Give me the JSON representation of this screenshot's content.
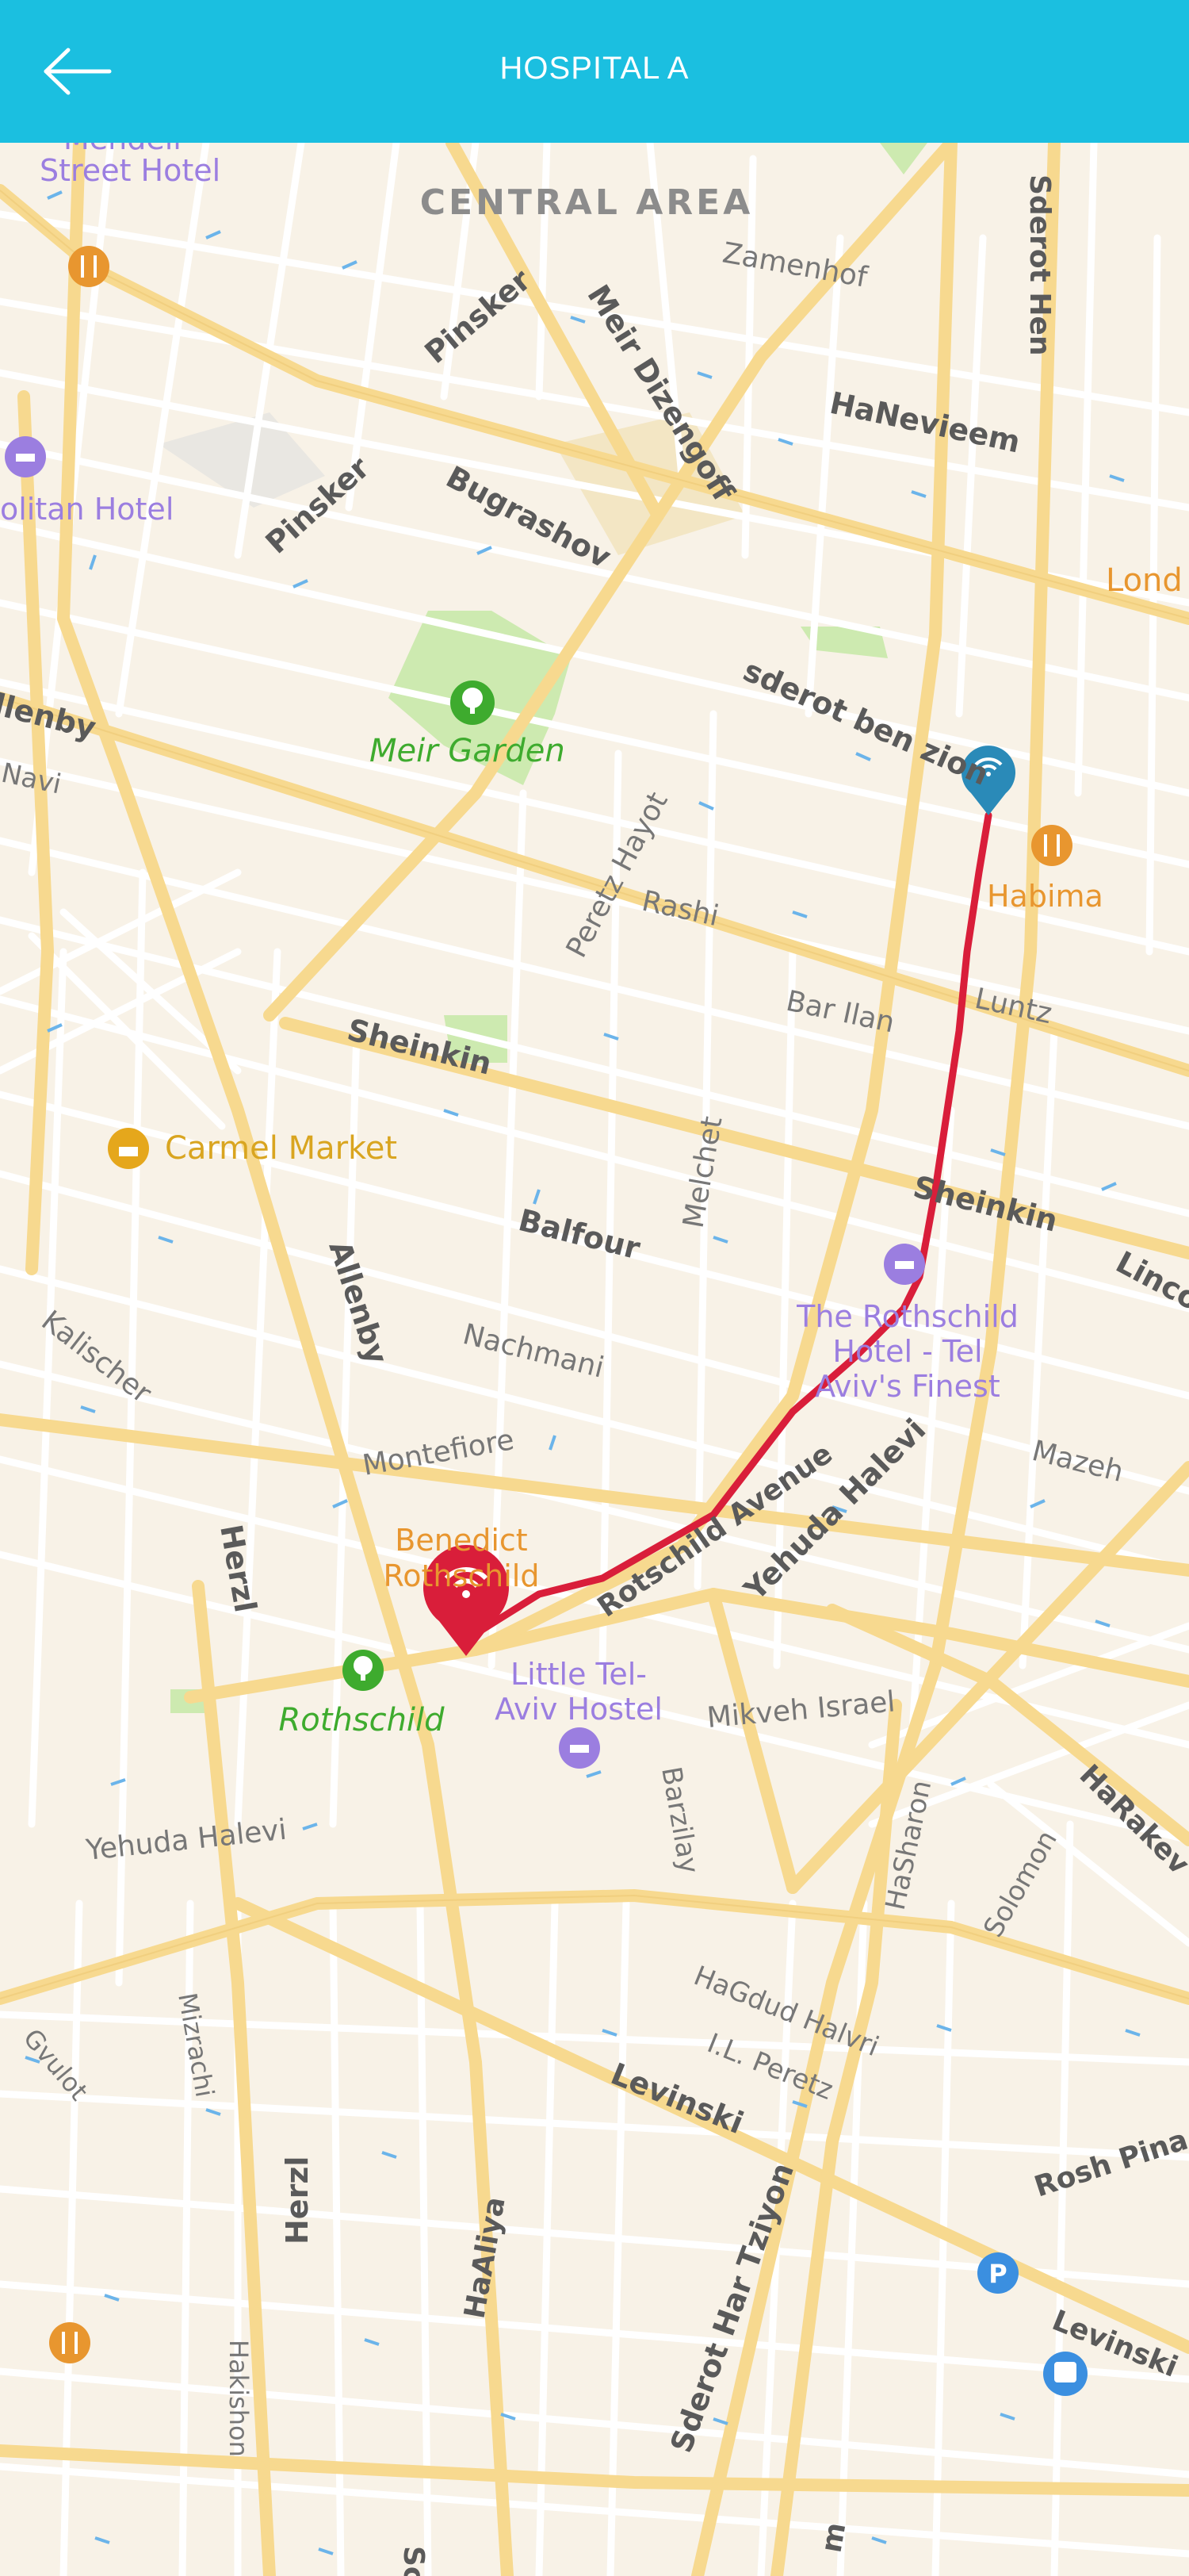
{
  "header": {
    "title": "HOSPITAL A",
    "back_icon": "arrow-left-icon",
    "background": "#1bbfe0"
  },
  "map": {
    "area_label": "CENTRAL AREA",
    "streets": [
      "Zamenhof",
      "Sderot Hen",
      "HaNevieem",
      "Pinsker",
      "Pinsker",
      "Meir Dizengoff",
      "Bugrashov",
      "sderot ben zion",
      "Peretz Hayot",
      "Rashi",
      "Bar Ilan",
      "Luntz",
      "Sheinkin",
      "Sheinkin",
      "Melchet",
      "Balfour",
      "Allenby",
      "Nachmani",
      "Kalischer",
      "Montefiore",
      "Rotschild Avenue",
      "Yehuda Halevi",
      "Mazeh",
      "Herzl",
      "Mikveh Israel",
      "Barzilay",
      "Yehuda Halevi",
      "HaSharon",
      "Solomon",
      "HaRakevet",
      "HaGdud Halvri",
      "I.L. Peretz",
      "Levinski",
      "Mizrachi",
      "Gvulot",
      "Herzl",
      "HaAliya",
      "Sderot Har Tziyon",
      "Rosh Pina",
      "Levinski",
      "Hakishon",
      "Lincoln",
      "Allenby",
      "Navi",
      "Sc",
      "Hm"
    ],
    "pois": [
      {
        "name": "Mendeli Street Hotel",
        "icon": "bed-icon"
      },
      {
        "name": "Metropolitan Hotel",
        "icon": "bed-icon"
      },
      {
        "name": "Meir Garden",
        "icon": "tree-icon"
      },
      {
        "name": "Habima",
        "icon": "fork-knife-icon"
      },
      {
        "name": "Carmel Market",
        "icon": "basket-icon"
      },
      {
        "name": "The Rothschild Hotel - Tel Aviv's Finest",
        "icon": "bed-icon"
      },
      {
        "name": "Benedict Rothschild",
        "icon": "fork-knife-icon"
      },
      {
        "name": "Rothschild",
        "icon": "tree-icon"
      },
      {
        "name": "Little Tel-Aviv Hostel",
        "icon": "bed-icon"
      },
      {
        "name": "Londo",
        "icon": "fork-knife-icon"
      }
    ],
    "route": {
      "color": "#d91e3a",
      "start_marker": "wifi-pin-blue-icon",
      "end_marker": "wifi-pin-red-icon"
    },
    "colors": {
      "land": "#f8f2e7",
      "major_road": "#f7d98f",
      "park": "#cdeab0",
      "poi_hotel": "#9b7ee0",
      "poi_food": "#e8962f",
      "poi_park": "#3eab2e"
    }
  },
  "labels": {
    "area": "CENTRAL AREA",
    "zamenhof": "Zamenhof",
    "sderot_hen": "Sderot Hen",
    "hanevieem": "HaNevieem",
    "pinsker1": "Pinsker",
    "pinsker2": "Pinsker",
    "dizengoff": "Meir Dizengoff",
    "bugrashov": "Bugrashov",
    "benzion": "sderot ben zion",
    "peretz": "Peretz Hayot",
    "rashi": "Rashi",
    "barilan": "Bar Ilan",
    "luntz": "Luntz",
    "sheinkin1": "Sheinkin",
    "sheinkin2": "Sheinkin",
    "melchet": "Melchet",
    "balfour": "Balfour",
    "allenby1": "Allenby",
    "allenby2": "llenby",
    "navi": "Navi",
    "nachmani": "Nachmani",
    "kalischer": "Kalischer",
    "montefiore": "Montefiore",
    "rotschild": "Rotschild Avenue",
    "yehuda1": "Yehuda Halevi",
    "yehuda2": "Yehuda Halevi",
    "mazeh": "Mazeh",
    "herzl1": "Herzl",
    "herzl2": "Herzl",
    "mikveh": "Mikveh Israel",
    "barzilay": "Barzilay",
    "hasharon": "HaSharon",
    "solomon": "Solomon",
    "harakevet": "HaRakev",
    "hagdud": "HaGdud Halvri",
    "ilperetz": "I.L. Peretz",
    "levinski1": "Levinski",
    "levinski2": "Levinski",
    "mizrachi": "Mizrachi",
    "gvulot": "Gvulot",
    "haaliya": "HaAliya",
    "hartziyon": "Sderot Har Tziyon",
    "roshpina": "Rosh Pina",
    "hakishon": "Hakishon",
    "lincoln": "Linco",
    "sc": "Sc",
    "hm": "m",
    "mendeli": "Mendeli",
    "street_hotel": "Street Hotel",
    "metropolitan": "olitan Hotel",
    "meir_garden": "Meir Garden",
    "habima": "Habima",
    "carmel": "Carmel Market",
    "rothschild_hotel_1": "The Rothschild",
    "rothschild_hotel_2": "Hotel - Tel",
    "rothschild_hotel_3": "Aviv's Finest",
    "benedict1": "Benedict",
    "benedict2": "Rothschild",
    "rothschild_park": "Rothschild",
    "little1": "Little Tel-",
    "little2": "Aviv Hostel",
    "londo": "Lond"
  }
}
